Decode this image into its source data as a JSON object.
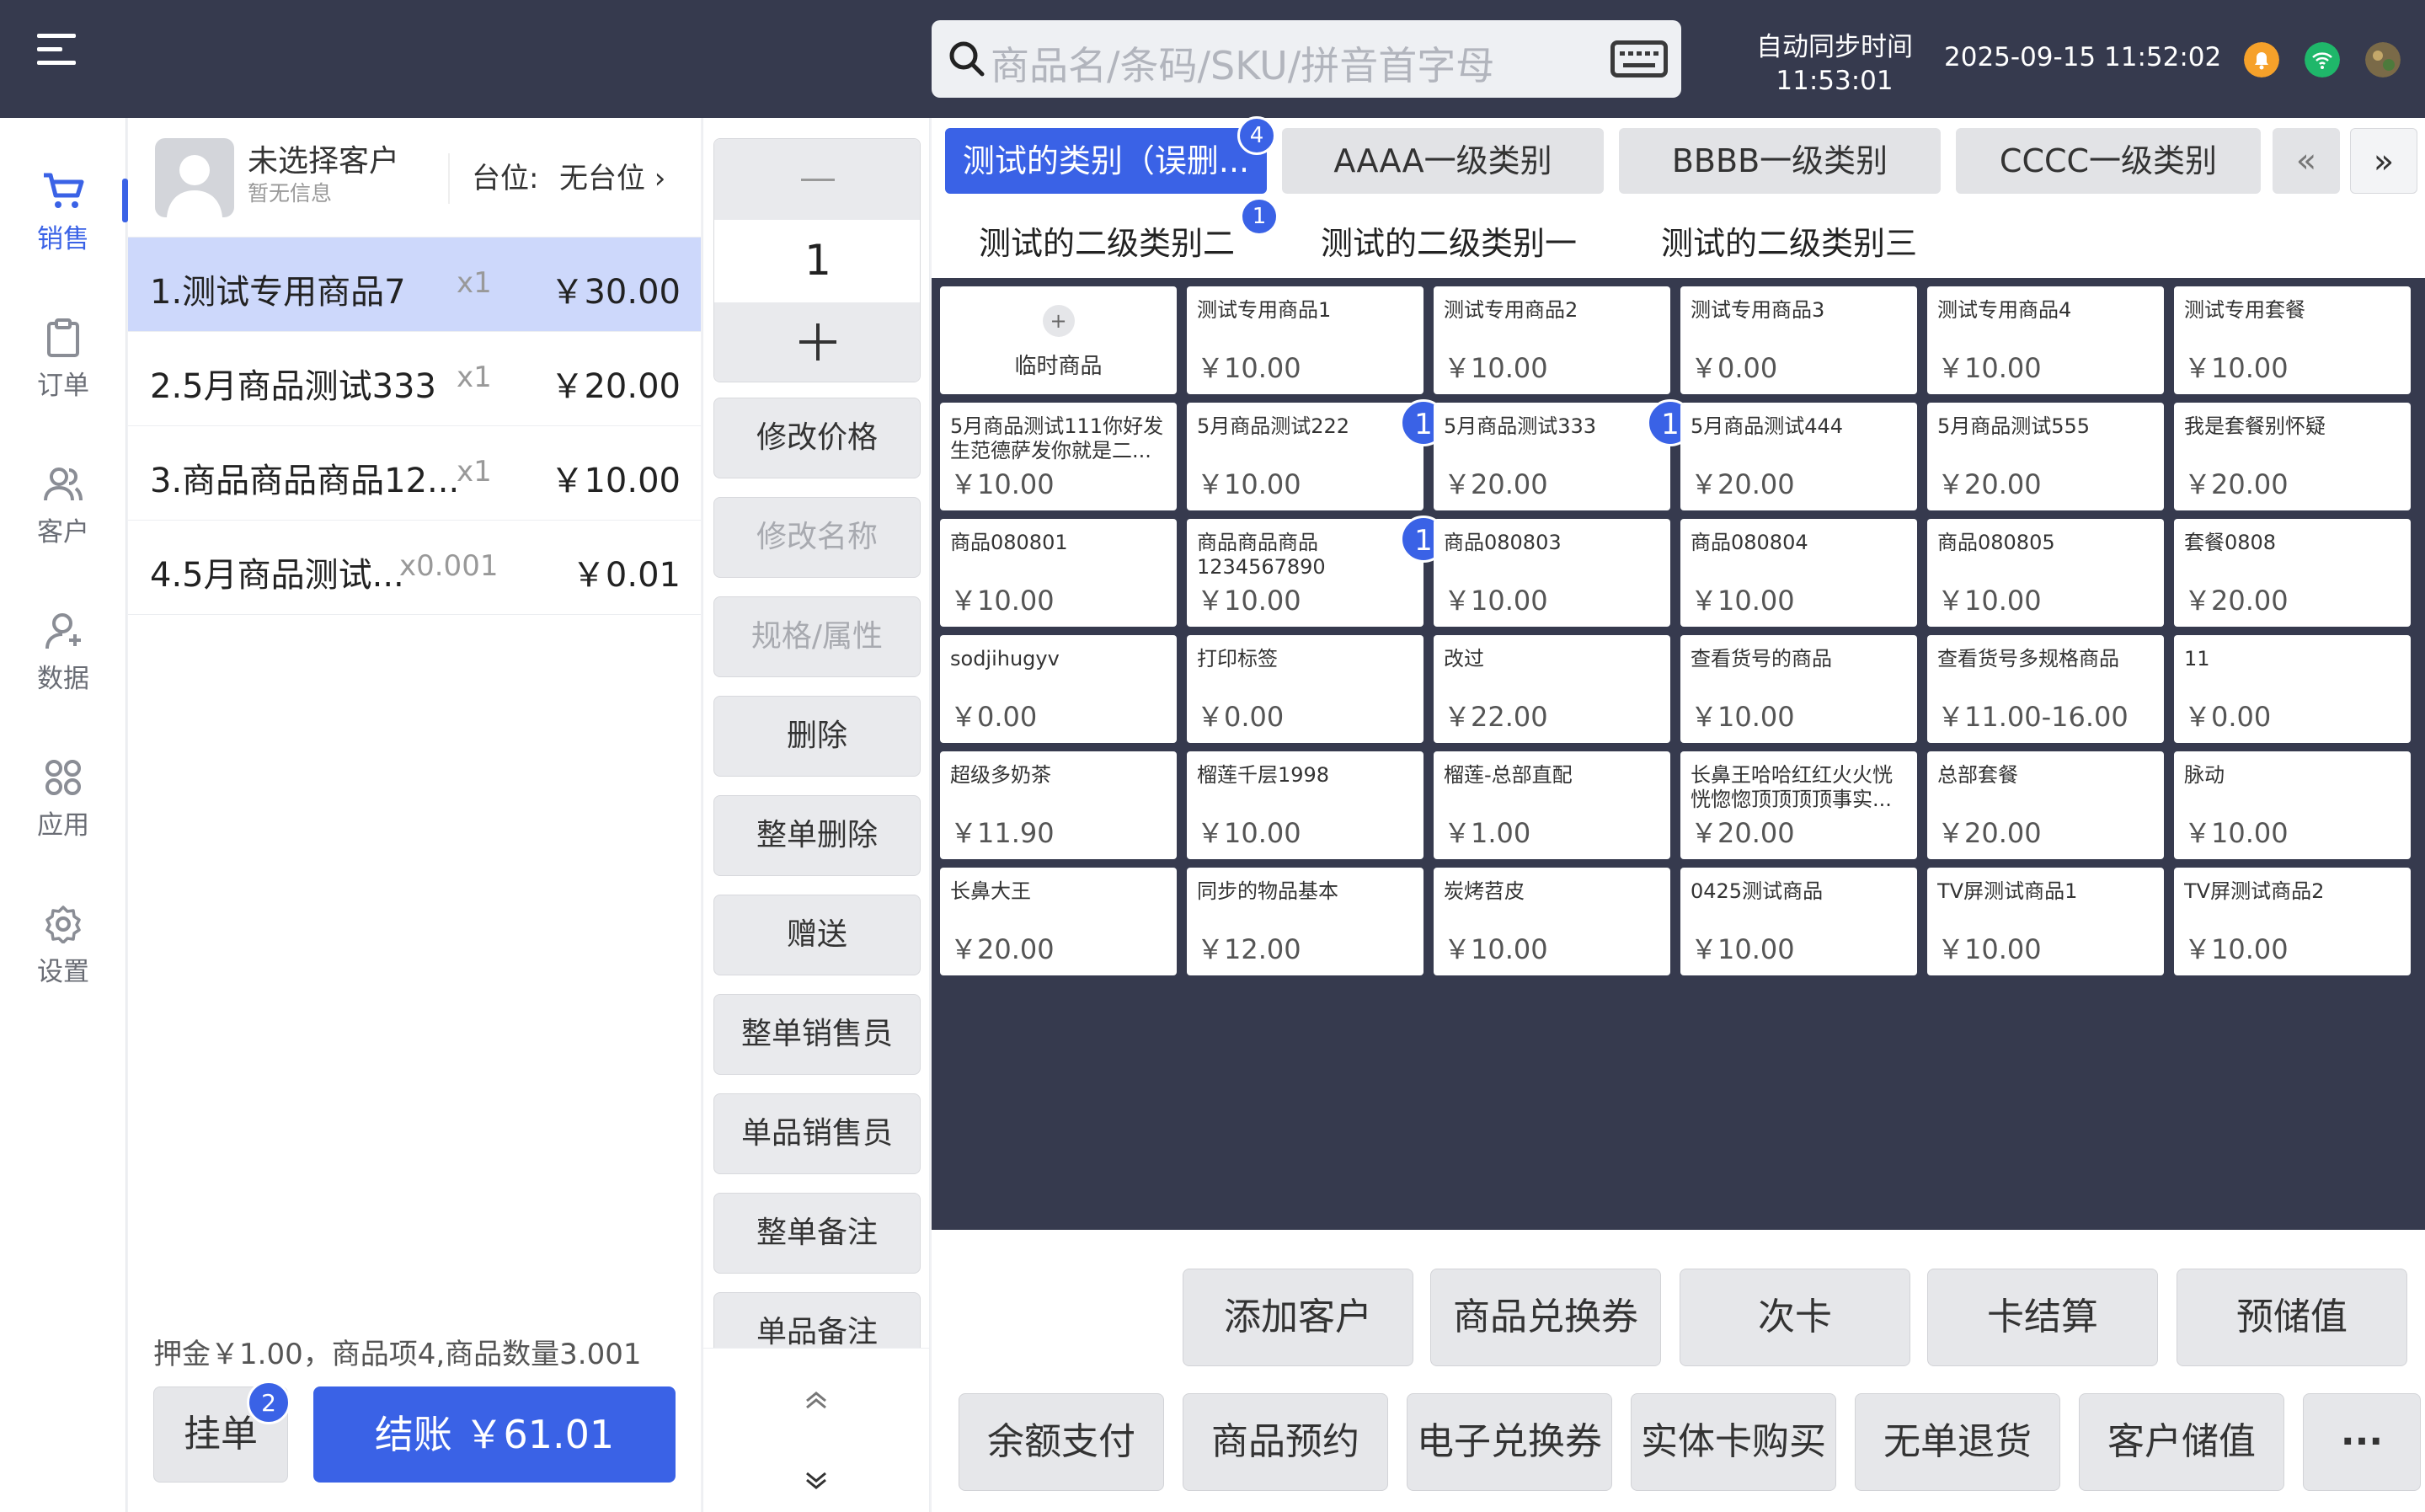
{
  "header": {
    "search_placeholder": "商品名/条码/SKU/拼音首字母",
    "sync_label": "自动同步时间",
    "sync_time": "11:53:01",
    "datetime": "2025-09-15 11:52:02"
  },
  "nav": {
    "items": [
      {
        "label": "销售",
        "icon": "cart-icon",
        "active": true
      },
      {
        "label": "订单",
        "icon": "clipboard-icon"
      },
      {
        "label": "客户",
        "icon": "users-icon"
      },
      {
        "label": "数据",
        "icon": "user-data-icon"
      },
      {
        "label": "应用",
        "icon": "apps-icon"
      },
      {
        "label": "设置",
        "icon": "gear-icon"
      }
    ]
  },
  "customer": {
    "name": "未选择客户",
    "info": "暂无信息",
    "table_label": "台位:",
    "table_value": "无台位 ›"
  },
  "cart": {
    "items": [
      {
        "name": "1.测试专用商品7",
        "qty": "x1",
        "price": "￥30.00",
        "selected": true
      },
      {
        "name": "2.5月商品测试333",
        "qty": "x1",
        "price": "￥20.00"
      },
      {
        "name": "3.商品商品商品12...",
        "qty": "x1",
        "price": "￥10.00"
      },
      {
        "name": "4.5月商品测试...",
        "qty": "x0.001",
        "price": "￥0.01"
      }
    ],
    "summary": "押金￥1.00，商品项4,商品数量3.001",
    "hold_label": "挂单",
    "hold_badge": "2",
    "checkout_label": "结账 ￥61.01"
  },
  "actions": {
    "qty_value": "1",
    "buttons": [
      {
        "label": "修改价格"
      },
      {
        "label": "修改名称",
        "disabled": true
      },
      {
        "label": "规格/属性",
        "disabled": true
      },
      {
        "label": "删除"
      },
      {
        "label": "整单删除"
      },
      {
        "label": "赠送"
      },
      {
        "label": "整单销售员"
      },
      {
        "label": "单品销售员"
      },
      {
        "label": "整单备注"
      },
      {
        "label": "单品备注"
      }
    ]
  },
  "categories": {
    "tabs": [
      {
        "label": "测试的类别（误删...",
        "active": true,
        "badge": "4"
      },
      {
        "label": "AAAA一级类别"
      },
      {
        "label": "BBBB一级类别"
      },
      {
        "label": "CCCC一级类别"
      }
    ],
    "prev": "«",
    "next": "»",
    "subtabs": [
      {
        "label": "测试的二级类别二",
        "badge": "1"
      },
      {
        "label": "测试的二级类别一"
      },
      {
        "label": "测试的二级类别三"
      }
    ]
  },
  "products": [
    {
      "name": "临时商品",
      "price": "",
      "temp": true,
      "plus": "+"
    },
    {
      "name": "测试专用商品1",
      "price": "￥10.00"
    },
    {
      "name": "测试专用商品2",
      "price": "￥10.00"
    },
    {
      "name": "测试专用商品3",
      "price": "￥0.00"
    },
    {
      "name": "测试专用商品4",
      "price": "￥10.00"
    },
    {
      "name": "测试专用套餐",
      "price": "￥10.00"
    },
    {
      "name": "5月商品测试111你好发生范德萨发你就是二...",
      "price": "￥10.00"
    },
    {
      "name": "5月商品测试222",
      "price": "￥10.00",
      "badge": "1"
    },
    {
      "name": "5月商品测试333",
      "price": "￥20.00",
      "badge": "1"
    },
    {
      "name": "5月商品测试444",
      "price": "￥20.00"
    },
    {
      "name": "5月商品测试555",
      "price": "￥20.00"
    },
    {
      "name": "我是套餐别怀疑",
      "price": "￥20.00"
    },
    {
      "name": "商品080801",
      "price": "￥10.00"
    },
    {
      "name": "商品商品商品1234567890",
      "price": "￥10.00",
      "badge": "1"
    },
    {
      "name": "商品080803",
      "price": "￥10.00"
    },
    {
      "name": "商品080804",
      "price": "￥10.00"
    },
    {
      "name": "商品080805",
      "price": "￥10.00"
    },
    {
      "name": "套餐0808",
      "price": "￥20.00"
    },
    {
      "name": "sodjihugyv",
      "price": "￥0.00"
    },
    {
      "name": "打印标签",
      "price": "￥0.00"
    },
    {
      "name": "改过",
      "price": "￥22.00"
    },
    {
      "name": "查看货号的商品",
      "price": "￥10.00"
    },
    {
      "name": "查看货号多规格商品",
      "price": "￥11.00-16.00"
    },
    {
      "name": "11",
      "price": "￥0.00"
    },
    {
      "name": "超级多奶茶",
      "price": "￥11.90"
    },
    {
      "name": "榴莲千层1998",
      "price": "￥10.00"
    },
    {
      "name": "榴莲-总部直配",
      "price": "￥1.00"
    },
    {
      "name": "长鼻王哈哈红红火火恍恍惚惚顶顶顶顶事实...",
      "price": "￥20.00"
    },
    {
      "name": "总部套餐",
      "price": "￥20.00"
    },
    {
      "name": "脉动",
      "price": "￥10.00"
    },
    {
      "name": "长鼻大王",
      "price": "￥20.00"
    },
    {
      "name": "同步的物品基本",
      "price": "￥12.00"
    },
    {
      "name": "炭烤苕皮",
      "price": "￥10.00"
    },
    {
      "name": "0425测试商品",
      "price": "￥10.00"
    },
    {
      "name": "TV屏测试商品1",
      "price": "￥10.00"
    },
    {
      "name": "TV屏测试商品2",
      "price": "￥10.00"
    }
  ],
  "functions": {
    "row1": [
      "添加客户",
      "商品兑换券",
      "次卡",
      "卡结算",
      "预储值"
    ],
    "row2": [
      "余额支付",
      "商品预约",
      "电子兑换券",
      "实体卡购买",
      "无单退货",
      "客户储值",
      "···"
    ]
  },
  "colors": {
    "primary": "#3a62e6",
    "dark": "#363a4e",
    "selected_row": "#cdd8fb"
  }
}
